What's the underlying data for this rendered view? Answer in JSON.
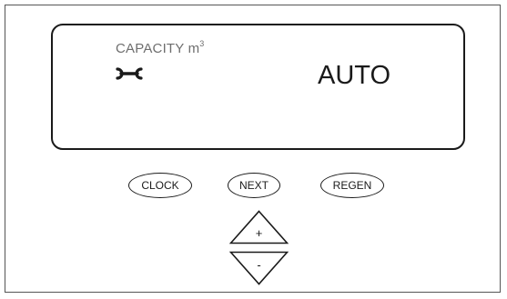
{
  "display": {
    "label": "CAPACITY m",
    "label_superscript": "3",
    "status_icon": "wrench-icon",
    "value": "AUTO"
  },
  "buttons": {
    "clock": "CLOCK",
    "next": "NEXT",
    "regen": "REGEN",
    "plus": "+",
    "minus": "-"
  },
  "colors": {
    "outline": "#1a1a1a",
    "label_gray": "#6e6e6e",
    "background": "#ffffff"
  }
}
